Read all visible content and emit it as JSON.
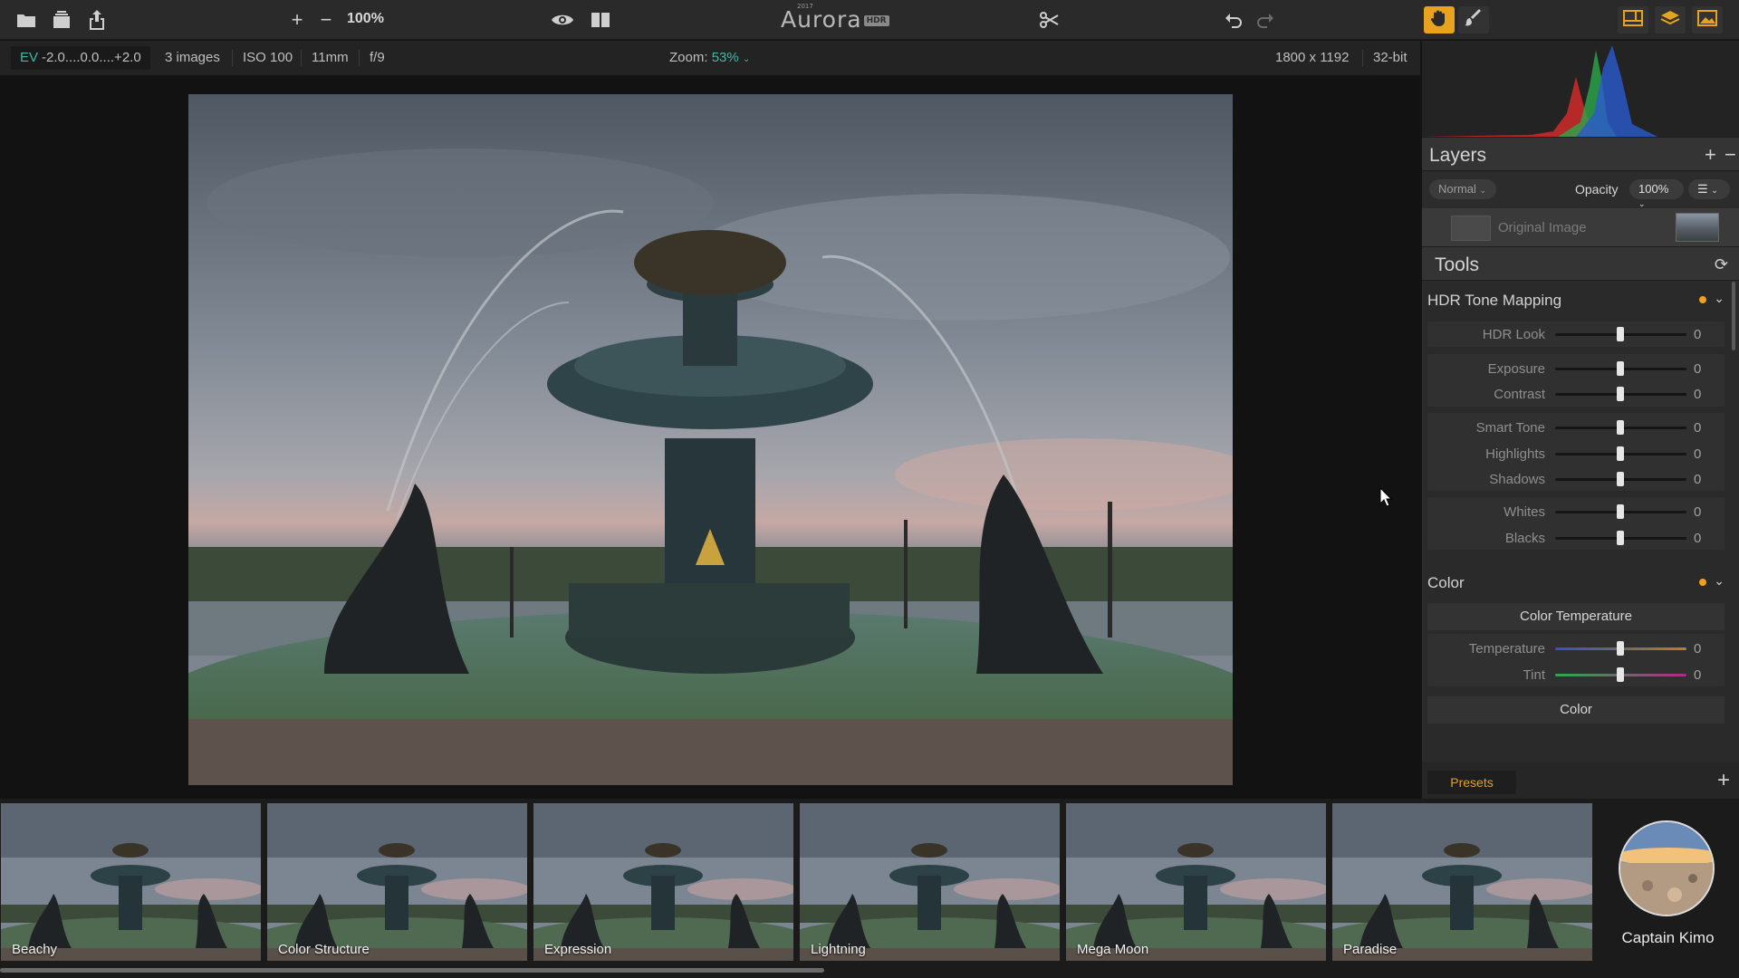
{
  "toolbar": {
    "zoom_value": "100%",
    "app_name": "Aurora",
    "app_year": "2017",
    "app_badge": "HDR",
    "icons": [
      "folder-icon",
      "layers-stack-icon",
      "export-icon",
      "zoom-in-icon",
      "zoom-out-icon",
      "eye-icon",
      "split-view-icon",
      "scissors-icon",
      "undo-icon",
      "redo-icon",
      "hand-icon",
      "brush-icon",
      "layout-icon",
      "layers-icon",
      "image-icon"
    ]
  },
  "infobar": {
    "ev_label": "EV",
    "ev_range": "-2.0....0.0....+2.0",
    "images": "3 images",
    "iso": "ISO 100",
    "focal": "11mm",
    "aperture": "f/9",
    "zoom_label": "Zoom:",
    "zoom_value": "53%",
    "dimensions": "1800 x 1192",
    "bit_depth": "32-bit"
  },
  "layers": {
    "title": "Layers",
    "blend_mode": "Normal",
    "opacity_label": "Opacity",
    "opacity_value": "100%",
    "layer_name": "Original Image"
  },
  "tools": {
    "title": "Tools",
    "groups": [
      {
        "title": "HDR Tone Mapping",
        "sliders": [
          {
            "label": "HDR Look",
            "value": "0"
          },
          {
            "label": "Exposure",
            "value": "0"
          },
          {
            "label": "Contrast",
            "value": "0"
          },
          {
            "label": "Smart Tone",
            "value": "0"
          },
          {
            "label": "Highlights",
            "value": "0"
          },
          {
            "label": "Shadows",
            "value": "0"
          },
          {
            "label": "Whites",
            "value": "0"
          },
          {
            "label": "Blacks",
            "value": "0"
          }
        ]
      },
      {
        "title": "Color",
        "sub_button": "Color Temperature",
        "sliders": [
          {
            "label": "Temperature",
            "value": "0"
          },
          {
            "label": "Tint",
            "value": "0"
          }
        ],
        "sub_button_2": "Color"
      }
    ]
  },
  "presets": {
    "tab_label": "Presets",
    "items": [
      "Beachy",
      "Color Structure",
      "Expression",
      "Lightning",
      "Mega Moon",
      "Paradise"
    ],
    "profile_name": "Captain Kimo"
  },
  "colors": {
    "accent_teal": "#3fb8a8",
    "accent_orange": "#f0a020"
  }
}
